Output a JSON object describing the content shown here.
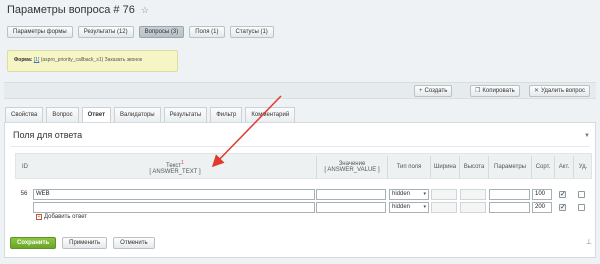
{
  "page": {
    "title": "Параметры вопроса # 76"
  },
  "top_tabs": [
    {
      "label": "Параметры формы"
    },
    {
      "label": "Результаты (12)"
    },
    {
      "label": "Вопросы (3)",
      "active": true
    },
    {
      "label": "Поля (1)"
    },
    {
      "label": "Статусы (1)"
    }
  ],
  "form_note": {
    "prefix": "Форма:",
    "id_link": "[1]",
    "text": " (aspro_priority_callback_s1) Заказать звонок"
  },
  "actions": {
    "create": "Создать",
    "copy": "Копировать",
    "delete": "Удалить вопрос"
  },
  "tabs2": [
    {
      "label": "Свойства"
    },
    {
      "label": "Вопрос"
    },
    {
      "label": "Ответ",
      "active": true
    },
    {
      "label": "Валидаторы"
    },
    {
      "label": "Результаты"
    },
    {
      "label": "Фильтр"
    },
    {
      "label": "Комментарий"
    }
  ],
  "panel": {
    "title": "Поля для ответа"
  },
  "grid": {
    "headers": {
      "id": "ID",
      "text": "Текст",
      "text_code": "[ ANSWER_TEXT ]",
      "value": "Значение",
      "value_code": "[ ANSWER_VALUE ]",
      "field_type": "Тип поля",
      "width": "Ширина",
      "height": "Высота",
      "params": "Параметры",
      "sort": "Сорт.",
      "active": "Акт.",
      "delete": "Уд."
    },
    "req_mark": "1",
    "rows": [
      {
        "id": "56",
        "text": "WEB",
        "value": "",
        "type": "hidden",
        "sort": "100",
        "active": true,
        "delete": false
      },
      {
        "id": "",
        "text": "",
        "value": "",
        "type": "hidden",
        "sort": "200",
        "active": true,
        "delete": false
      }
    ],
    "add_answer": "Добавить ответ"
  },
  "bottom": {
    "save": "Сохранить",
    "apply": "Применить",
    "cancel": "Отменить"
  },
  "colors": {
    "save_green": "#7ab636",
    "annotation_arrow": "#e03a2f"
  }
}
